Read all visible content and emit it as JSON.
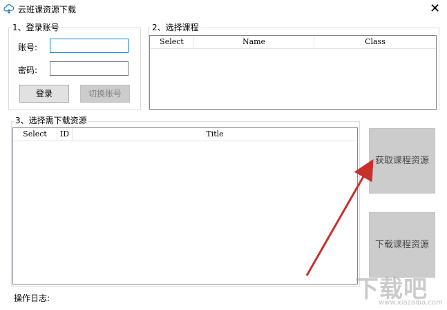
{
  "window": {
    "title": "云班课资源下载",
    "close_glyph": "✕"
  },
  "login": {
    "group_label": "1、登录账号",
    "account_label": "账号:",
    "password_label": "密码:",
    "account_value": "",
    "password_value": "",
    "login_button": "登录",
    "switch_button": "切换账号"
  },
  "course": {
    "group_label": "2、选择课程",
    "columns": [
      "Select",
      "Name",
      "Class"
    ]
  },
  "resources": {
    "group_label": "3、选择需下载资源",
    "columns": [
      "Select",
      "ID",
      "Title"
    ]
  },
  "actions": {
    "fetch_button": "获取课程资源",
    "download_button": "下载课程资源"
  },
  "log": {
    "label": "操作日志:"
  },
  "watermark": {
    "text": "下载吧",
    "url": "www.xiazaiba.com"
  },
  "annotation": {
    "arrow_color": "#c9302c"
  }
}
